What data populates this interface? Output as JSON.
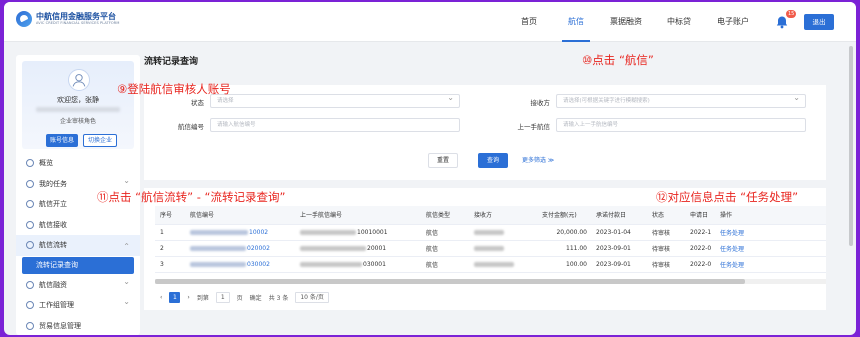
{
  "header": {
    "logo_main": "中航信用金融服务平台",
    "logo_sub": "AVIC CREDIT FINANCIAL SERVICES PLATFORM",
    "nav": [
      {
        "label": "首页",
        "active": false
      },
      {
        "label": "航信",
        "active": true
      },
      {
        "label": "票据融资",
        "active": false
      },
      {
        "label": "中标贷",
        "active": false
      },
      {
        "label": "电子账户",
        "active": false
      }
    ],
    "notification_count": "15",
    "logout_label": "退出"
  },
  "page_title": "流转记录查询",
  "sidebar": {
    "welcome": "欢迎您，张静",
    "role": "企业审核角色",
    "account_btn": "账号信息",
    "switch_btn": "切换企业",
    "menu": [
      {
        "label": "概览",
        "expandable": false
      },
      {
        "label": "我的任务",
        "expandable": true
      },
      {
        "label": "航信开立",
        "expandable": false
      },
      {
        "label": "航信接收",
        "expandable": false
      },
      {
        "label": "航信流转",
        "expandable": true,
        "open": true
      },
      {
        "label": "流转记录查询",
        "sub": true
      },
      {
        "label": "航信融资",
        "expandable": true
      },
      {
        "label": "工作组管理",
        "expandable": true
      },
      {
        "label": "贸易信息管理",
        "expandable": false
      }
    ]
  },
  "search": {
    "status_label": "状态",
    "status_placeholder": "请选择",
    "receiver_label": "接收方",
    "receiver_placeholder": "请选择(可根据关键字进行模糊搜索)",
    "code_label": "航信编号",
    "code_placeholder": "请输入航信编号",
    "prev_label": "上一手航信",
    "prev_placeholder": "请输入上一手航信编号",
    "reset_btn": "重置",
    "query_btn": "查询",
    "more_filter": "更多筛选 ≫"
  },
  "table": {
    "headers": [
      "序号",
      "航信编号",
      "上一手航信编号",
      "航信类型",
      "接收方",
      "支付金额(元)",
      "承诺付款日",
      "状态",
      "申请日",
      "操作"
    ],
    "rows": [
      {
        "idx": "1",
        "code_tail": "10002",
        "prev_tail": "10010001",
        "type": "航信",
        "amount": "20,000.00",
        "due": "2023-01-04",
        "status": "待审核",
        "apply": "2022-1",
        "action": "任务处理"
      },
      {
        "idx": "2",
        "code_tail": "020002",
        "prev_tail": "20001",
        "type": "航信",
        "amount": "111.00",
        "due": "2023-09-01",
        "status": "待审核",
        "apply": "2022-0",
        "action": "任务处理"
      },
      {
        "idx": "3",
        "code_tail": "030002",
        "prev_tail": "030001",
        "type": "航信",
        "amount": "100.00",
        "due": "2023-09-01",
        "status": "待审核",
        "apply": "2022-0",
        "action": "任务处理"
      }
    ]
  },
  "pager": {
    "prev": "‹",
    "current": "1",
    "next": "›",
    "goto": "到第",
    "page_input": "1",
    "page_unit": "页",
    "confirm": "确定",
    "total": "共 3 条",
    "page_size": "10 条/页"
  },
  "annotations": {
    "step9": "⑨登陆航信审核人账号",
    "step10": "⑩点击 “航信”",
    "step11": "⑪点击 “航信流转” - “流转记录查询”",
    "step12": "⑫对应信息点击 “任务处理”"
  },
  "colors": {
    "primary": "#2b6fd6",
    "annotation": "#e8251f",
    "border": "#7b22d6"
  }
}
